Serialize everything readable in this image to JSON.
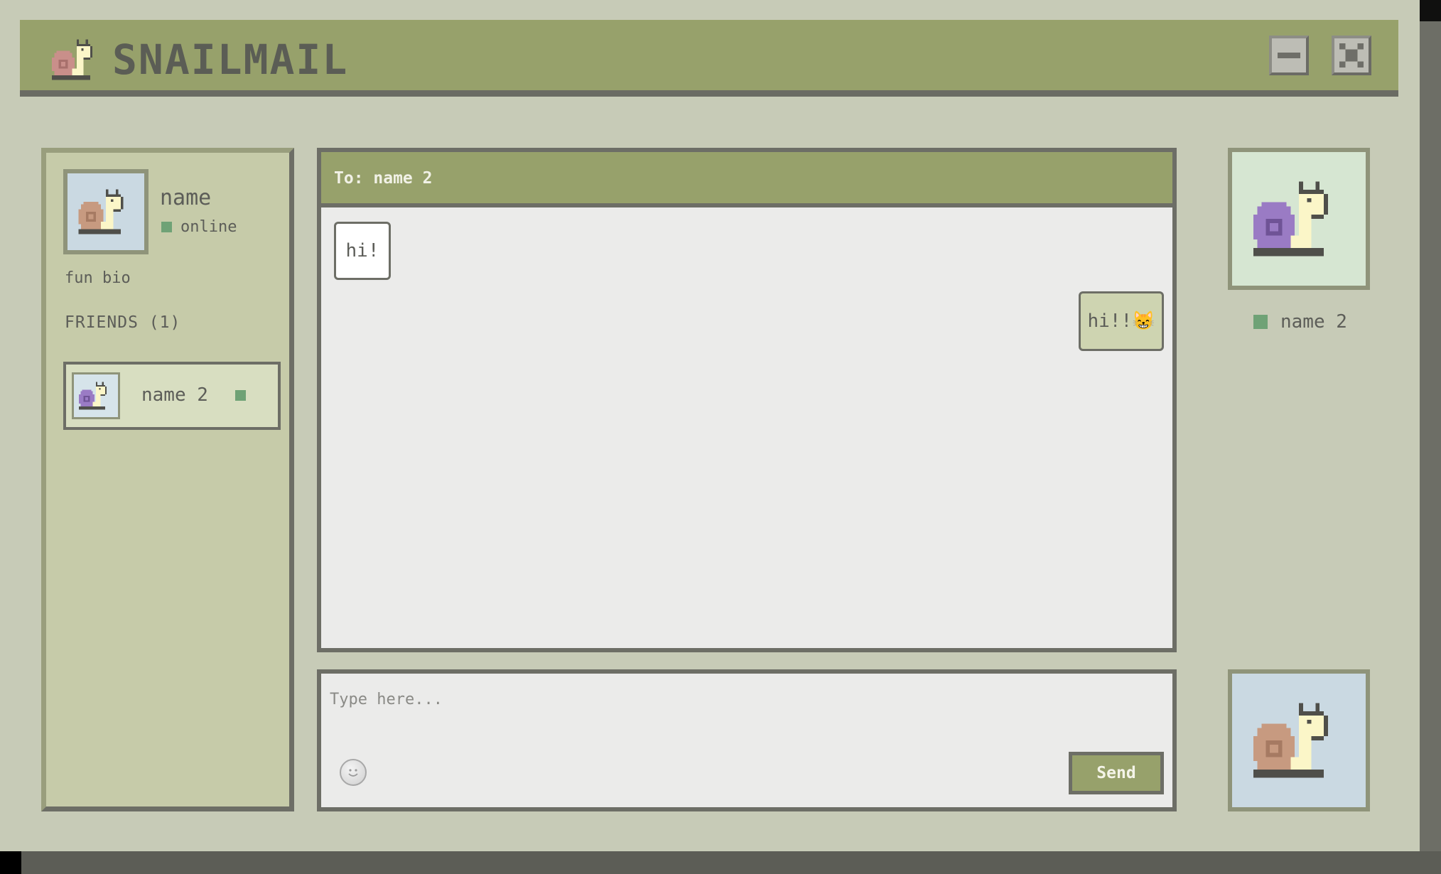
{
  "app": {
    "title": "SNAILMAIL",
    "logo_icon": "snail-icon",
    "minimize_icon": "minimize-icon",
    "close_icon": "close-icon"
  },
  "colors": {
    "accent": "#97a16b",
    "border": "#6d6e66",
    "online": "#6fa276",
    "background": "#c7cbb7"
  },
  "profile": {
    "name": "name",
    "status": "online",
    "bio": "fun bio",
    "avatar_icon": "snail-avatar-icon"
  },
  "friends": {
    "header": "FRIENDS (1)",
    "items": [
      {
        "name": "name 2",
        "status": "online",
        "avatar_icon": "purple-snail-icon"
      }
    ]
  },
  "chat": {
    "to_label": "To: name 2",
    "messages": [
      {
        "direction": "incoming",
        "text": "hi!"
      },
      {
        "direction": "outgoing",
        "text": "hi!!😸"
      }
    ]
  },
  "compose": {
    "placeholder": "Type here...",
    "value": "",
    "emoji_icon": "smiley-icon",
    "send_label": "Send"
  },
  "contact": {
    "name": "name 2",
    "status": "online",
    "avatar_icon": "purple-snail-icon"
  },
  "self": {
    "avatar_icon": "snail-avatar-icon"
  }
}
